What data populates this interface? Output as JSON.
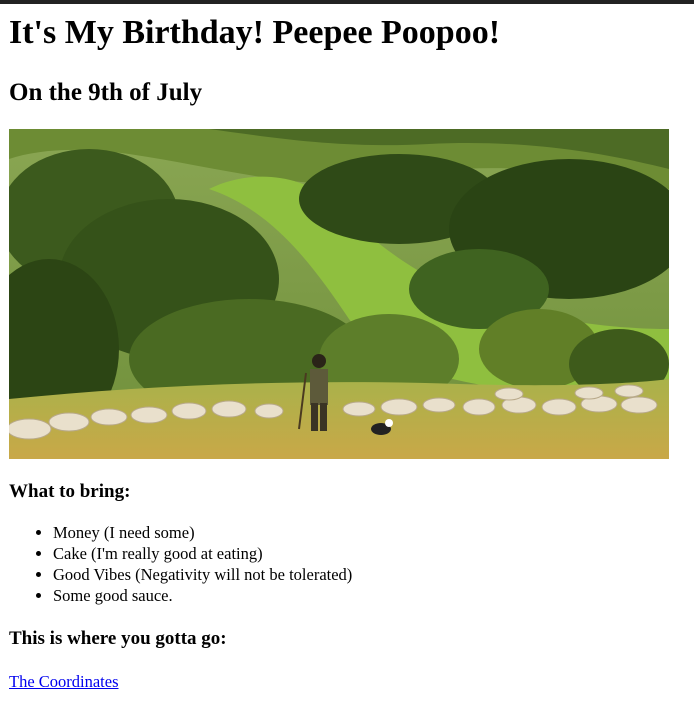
{
  "heading": "It's My Birthday! Peepee Poopoo!",
  "subheading": "On the 9th of July",
  "photo": {
    "icon": "landscape-photo"
  },
  "bring": {
    "heading": "What to bring:",
    "items": [
      "Money (I need some)",
      "Cake (I'm really good at eating)",
      "Good Vibes (Negativity will not be tolerated)",
      "Some good sauce."
    ]
  },
  "location": {
    "heading": "This is where you gotta go:",
    "link_label": "The Coordinates"
  },
  "colors": {
    "link": "#0000ee",
    "topbar": "#222222"
  }
}
